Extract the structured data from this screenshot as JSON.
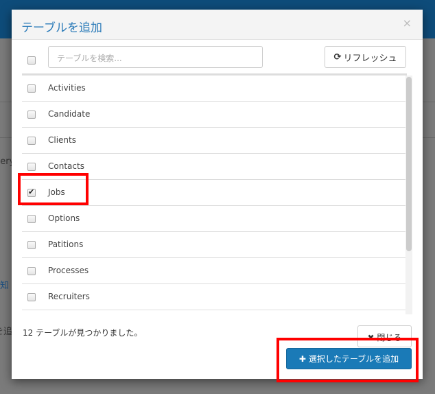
{
  "background": {
    "fragments": [
      "uery",
      "知",
      "を追"
    ]
  },
  "modal": {
    "title": "テーブルを追加",
    "close_icon": "×",
    "search_placeholder": "テーブルを検索...",
    "refresh_label": "リフレッシュ",
    "tables": [
      {
        "name": "Activities",
        "checked": false
      },
      {
        "name": "Candidate",
        "checked": false
      },
      {
        "name": "Clients",
        "checked": false
      },
      {
        "name": "Contacts",
        "checked": false
      },
      {
        "name": "Jobs",
        "checked": true
      },
      {
        "name": "Options",
        "checked": false
      },
      {
        "name": "Patitions",
        "checked": false
      },
      {
        "name": "Processes",
        "checked": false
      },
      {
        "name": "Recruiters",
        "checked": false
      }
    ],
    "count_text": "12 テーブルが見つかりました。",
    "close_label": "閉じる",
    "add_label": "選択したテーブルを追加"
  },
  "colors": {
    "accent": "#1a7ab7",
    "highlight": "#ff0000",
    "header": "#0e4c7a"
  }
}
